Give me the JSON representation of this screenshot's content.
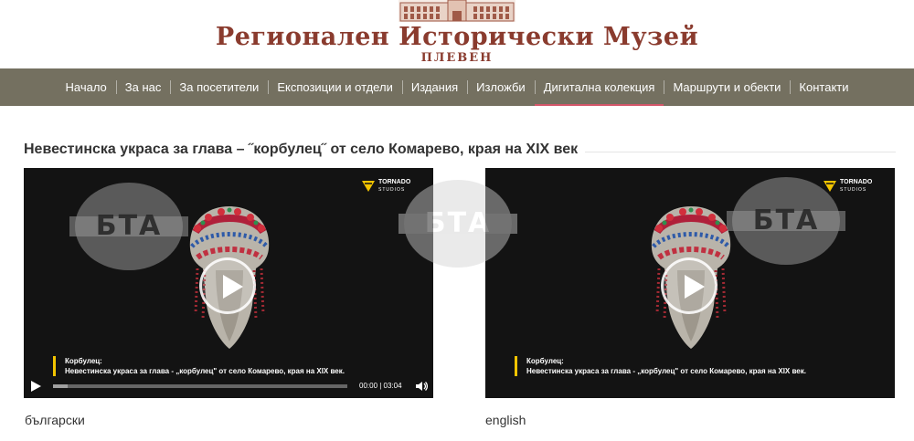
{
  "header": {
    "title": "Регионален Исторически Музей",
    "subtitle": "ПЛЕВЕН"
  },
  "nav": {
    "items": [
      {
        "label": "Начало"
      },
      {
        "label": "За нас"
      },
      {
        "label": "За посетители"
      },
      {
        "label": "Експозиции и отдели"
      },
      {
        "label": "Издания"
      },
      {
        "label": "Изложби"
      },
      {
        "label": "Дигитална колекция",
        "active": true
      },
      {
        "label": "Маршрути и обекти"
      },
      {
        "label": "Контакти"
      }
    ]
  },
  "page": {
    "title": "Невестинска украса за глава – ˝корбулец˝ от село Комарево, края на XIX век"
  },
  "videos": [
    {
      "watermark": "БТА",
      "studio": "TORNADO",
      "studio_sub": "STUDIOS",
      "caption_line1": "Корбулец:",
      "caption_line2": "Невестинска украса за глава - „корбулец\" от село Комарево, края на XIX век.",
      "time": "00:00 | 03:04",
      "progress": 0.05,
      "language": "български"
    },
    {
      "watermark": "БТА",
      "studio": "TORNADO",
      "studio_sub": "STUDIOS",
      "caption_line1": "Корбулец:",
      "caption_line2": "Невестинска украса за глава - „корбулец\" от село Комарево, края на XIX век.",
      "language": "english"
    }
  ],
  "watermark_mid": "БТА",
  "colors": {
    "nav_bg": "#747060",
    "accent": "#d4566a",
    "logo": "#8a3b2e",
    "caption_bar": "#f2c400"
  }
}
